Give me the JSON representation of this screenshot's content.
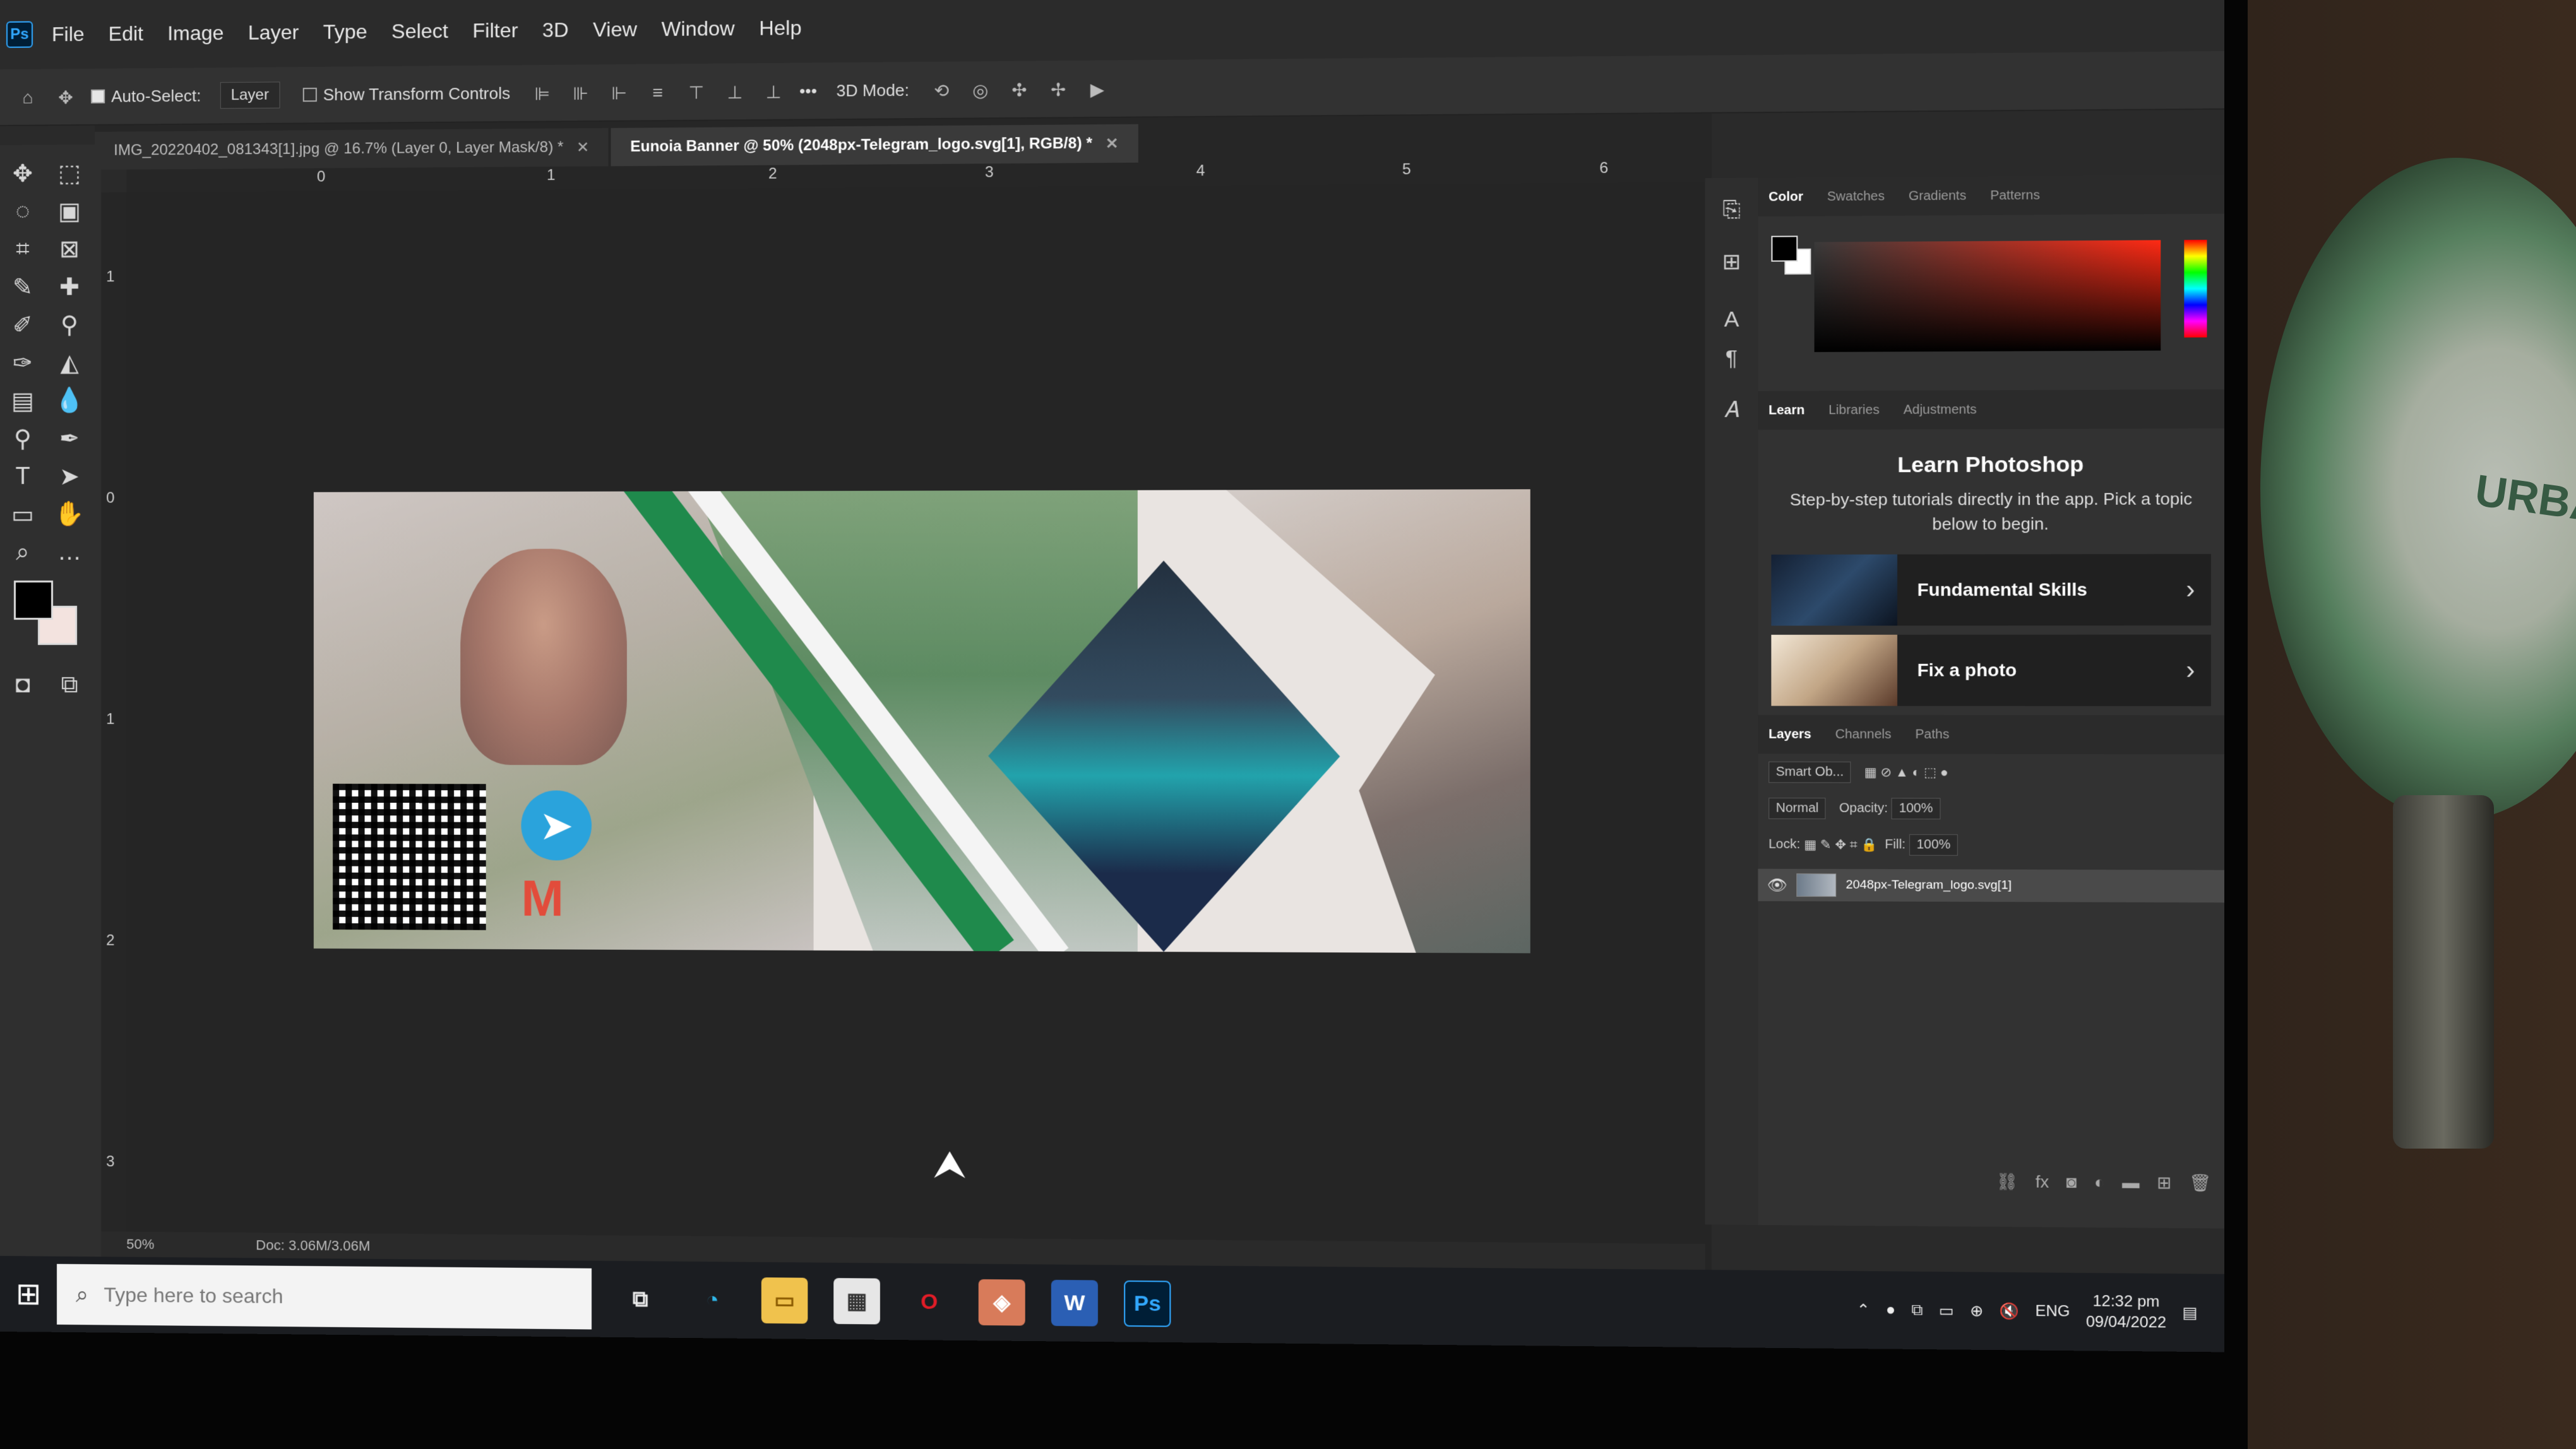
{
  "menu": [
    "File",
    "Edit",
    "Image",
    "Layer",
    "Type",
    "Select",
    "Filter",
    "3D",
    "View",
    "Window",
    "Help"
  ],
  "options_bar": {
    "auto_select_label": "Auto-Select:",
    "layer_select": "Layer",
    "show_transform_label": "Show Transform Controls",
    "more": "•••",
    "mode_3d": "3D Mode:"
  },
  "tabs": [
    {
      "label": "IMG_20220402_081343[1].jpg @ 16.7% (Layer 0, Layer Mask/8) *",
      "active": false
    },
    {
      "label": "Eunoia Banner @ 50% (2048px-Telegram_logo.svg[1], RGB/8) *",
      "active": true
    }
  ],
  "ruler_top": [
    "0",
    "1",
    "2",
    "3",
    "4",
    "5",
    "6"
  ],
  "ruler_left": [
    "1",
    "0",
    "1",
    "2",
    "3"
  ],
  "panels": {
    "color_tabs": [
      "Color",
      "Swatches",
      "Gradients",
      "Patterns"
    ],
    "learn_tabs": [
      "Learn",
      "Libraries",
      "Adjustments"
    ],
    "learn_title": "Learn Photoshop",
    "learn_subtitle": "Step-by-step tutorials directly in the app. Pick a topic below to begin.",
    "learn_cards": [
      "Fundamental Skills",
      "Fix a photo"
    ],
    "layers_tabs": [
      "Layers",
      "Channels",
      "Paths"
    ],
    "filter_kind": "Smart Ob...",
    "blend_mode": "Normal",
    "opacity_label": "Opacity:",
    "opacity_value": "100%",
    "lock_label": "Lock:",
    "fill_label": "Fill:",
    "fill_value": "100%",
    "layer_name": "2048px-Telegram_logo.svg[1]"
  },
  "status": {
    "zoom": "50%",
    "doc": "Doc: 3.06M/3.06M"
  },
  "taskbar": {
    "search_placeholder": "Type here to search",
    "lang": "ENG",
    "time": "12:32 pm",
    "date": "09/04/2022"
  },
  "fan_brand": "URBA",
  "colors": {
    "accent": "#31a8ff",
    "banner_green": "#1f8a4c",
    "telegram": "#2aa3dc"
  }
}
